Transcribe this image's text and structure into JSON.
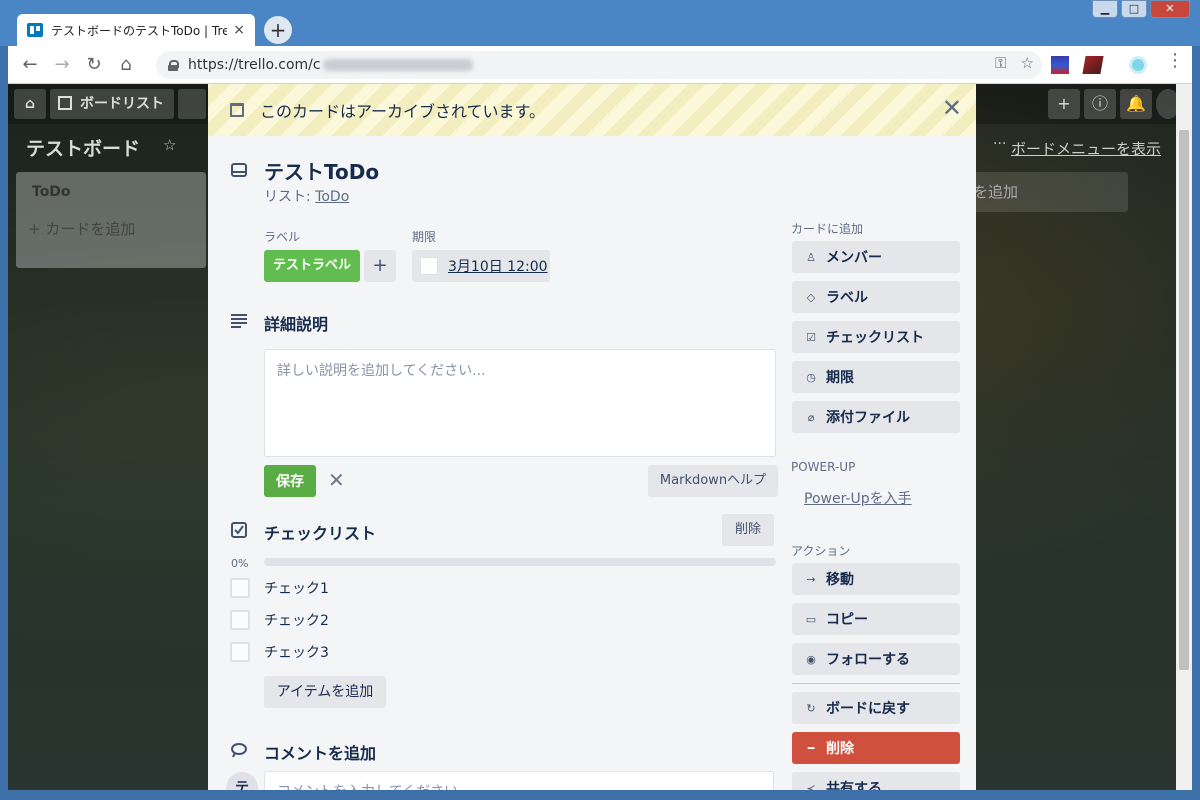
{
  "browser": {
    "tab_title": "テストボードのテストToDo | Trello",
    "tab_close": "×",
    "new_tab": "+",
    "url": "https://trello.com/c",
    "win_min": "▁",
    "win_max": "□",
    "win_close": "✕"
  },
  "board": {
    "home_label": "⌂",
    "boards_label": "ボードリスト",
    "title": "テストボード",
    "menu_label": "ボードメニューを表示",
    "list_title": "ToDo",
    "list_add_card": "+ カードを追加",
    "add_list": "を追加",
    "header_plus": "+",
    "header_info": "ⓘ",
    "header_bell": "🔔"
  },
  "card": {
    "archived_banner": "このカードはアーカイブされています。",
    "title": "テストToDo",
    "list_prefix": "リスト: ",
    "list_name": "ToDo",
    "labels_heading": "ラベル",
    "label_name": "テストラベル",
    "label_color": "#61bd4f",
    "due_heading": "期限",
    "due_date": "3月10日 12:00",
    "description_heading": "詳細説明",
    "description_placeholder": "詳しい説明を追加してください...",
    "save": "保存",
    "markdown_help": "Markdownヘルプ",
    "checklist_heading": "チェックリスト",
    "checklist_delete": "削除",
    "checklist_percent_label": "0%",
    "checklist_progress": 0,
    "checklist_items": [
      "チェック1",
      "チェック2",
      "チェック3"
    ],
    "add_item": "アイテムを追加",
    "comment_heading": "コメントを追加",
    "comment_placeholder": "コメントを入力してください...",
    "avatar_initial": "テ"
  },
  "sidebar": {
    "add_heading": "カードに追加",
    "add_buttons": [
      {
        "icon": "member-icon",
        "label": "メンバー"
      },
      {
        "icon": "label-icon",
        "label": "ラベル"
      },
      {
        "icon": "checklist-icon",
        "label": "チェックリスト"
      },
      {
        "icon": "clock-icon",
        "label": "期限"
      },
      {
        "icon": "attachment-icon",
        "label": "添付ファイル"
      }
    ],
    "powerup_heading": "POWER-UP",
    "powerup_link": "Power-Upを入手",
    "actions_heading": "アクション",
    "action_buttons": [
      {
        "icon": "arrow-right-icon",
        "label": "移動"
      },
      {
        "icon": "copy-icon",
        "label": "コピー"
      },
      {
        "icon": "eye-icon",
        "label": "フォローする"
      }
    ],
    "restore_label": "ボードに戻す",
    "delete_label": "削除",
    "delete_color": "#cf513d",
    "share_label": "共有する"
  }
}
